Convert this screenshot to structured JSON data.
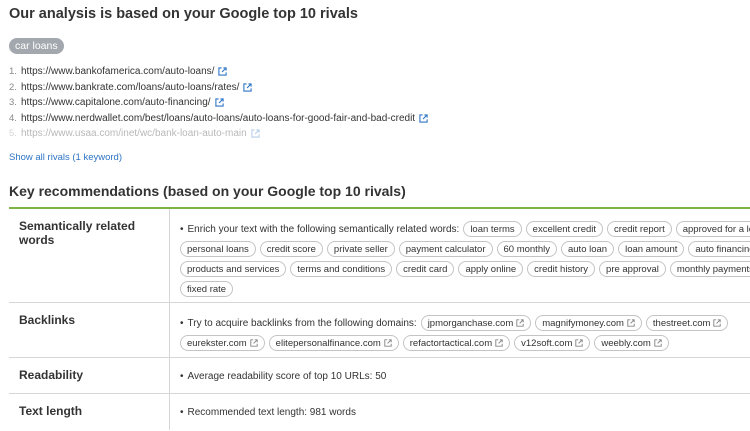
{
  "header": {
    "title": "Our analysis is based on your Google top 10 rivals",
    "keyword_badge": "car loans"
  },
  "rivals": [
    {
      "num": "1.",
      "url": "https://www.bankofamerica.com/auto-loans/"
    },
    {
      "num": "2.",
      "url": "https://www.bankrate.com/loans/auto-loans/rates/"
    },
    {
      "num": "3.",
      "url": "https://www.capitalone.com/auto-financing/"
    },
    {
      "num": "4.",
      "url": "https://www.nerdwallet.com/best/loans/auto-loans/auto-loans-for-good-fair-and-bad-credit"
    },
    {
      "num": "5.",
      "url": "https://www.usaa.com/inet/wc/bank-loan-auto-main"
    }
  ],
  "show_all_link": "Show all rivals (1 keyword)",
  "recommendations": {
    "title": "Key recommendations (based on your Google top 10 rivals)",
    "semantic": {
      "label": "Semantically related words",
      "intro": "Enrich your text with the following semantically related words:",
      "words": [
        "loan terms",
        "excellent credit",
        "credit report",
        "approved for a loan",
        "personal loans",
        "credit score",
        "private seller",
        "payment calculator",
        "60 monthly",
        "auto loan",
        "loan amount",
        "auto financing",
        "products and services",
        "terms and conditions",
        "credit card",
        "apply online",
        "credit history",
        "pre approval",
        "monthly payments",
        "fixed rate"
      ]
    },
    "backlinks": {
      "label": "Backlinks",
      "intro": "Try to acquire backlinks from the following domains:",
      "domains": [
        "jpmorganchase.com",
        "magnifymoney.com",
        "thestreet.com",
        "eurekster.com",
        "elitepersonalfinance.com",
        "refactortactical.com",
        "v12soft.com",
        "weebly.com"
      ]
    },
    "readability": {
      "label": "Readability",
      "text": "Average readability score of top 10 URLs:  50"
    },
    "text_length": {
      "label": "Text length",
      "text": "Recommended text length: 981 words"
    }
  },
  "colors": {
    "accent_green": "#7cb342",
    "link_blue": "#2d74c4",
    "badge_gray": "#a3a8ae"
  }
}
